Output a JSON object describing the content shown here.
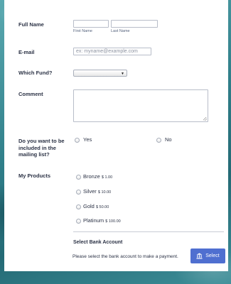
{
  "form": {
    "full_name": {
      "label": "Full Name",
      "first_label": "First Name",
      "last_label": "Last Name"
    },
    "email": {
      "label": "E-mail",
      "placeholder": "ex: myname@example.com"
    },
    "fund": {
      "label": "Which Fund?",
      "selected": ""
    },
    "comment": {
      "label": "Comment"
    },
    "mailing_list": {
      "label": "Do you want to be included in the mailing list?",
      "options": [
        "Yes",
        "No"
      ]
    },
    "products": {
      "label": "My Products",
      "items": [
        {
          "name": "Bronze",
          "price": "$ 1.00"
        },
        {
          "name": "Silver",
          "price": "$ 10.00"
        },
        {
          "name": "Gold",
          "price": "$ 50.00"
        },
        {
          "name": "Platinum",
          "price": "$ 100.00"
        }
      ]
    },
    "bank": {
      "title": "Select Bank Account",
      "help": "Please select the bank account to make a payment.",
      "button_label": "Select",
      "button_icon": "bank-icon",
      "button_color": "#4f6fd0"
    }
  }
}
